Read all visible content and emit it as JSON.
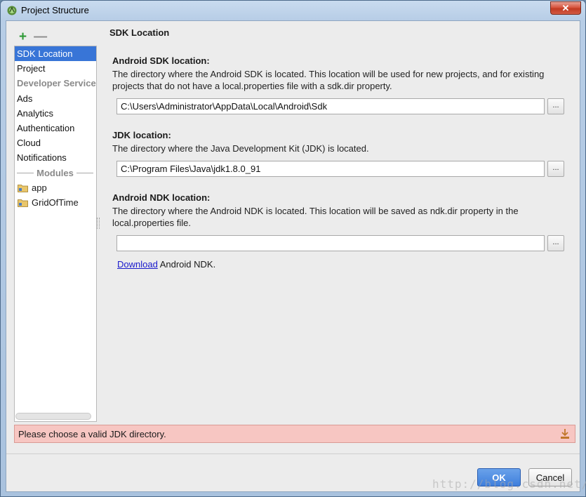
{
  "window": {
    "title": "Project Structure",
    "close_label": "✕"
  },
  "toolbar": {
    "add_label": "+",
    "remove_label": "—"
  },
  "sidebar": {
    "items": [
      {
        "label": "SDK Location",
        "selected": true
      },
      {
        "label": "Project"
      }
    ],
    "dev_services_header": "Developer Services",
    "dev_services": [
      "Ads",
      "Analytics",
      "Authentication",
      "Cloud",
      "Notifications"
    ],
    "modules_header": "Modules",
    "modules": [
      "app",
      "GridOfTime"
    ]
  },
  "main": {
    "section_title": "SDK Location",
    "android_sdk": {
      "title": "Android SDK location:",
      "description": "The directory where the Android SDK is located. This location will be used for new projects, and for existing projects that do not have a local.properties file with a sdk.dir property.",
      "value": "C:\\Users\\Administrator\\AppData\\Local\\Android\\Sdk",
      "browse_label": "..."
    },
    "jdk": {
      "title": "JDK location:",
      "description": "The directory where the Java Development Kit (JDK) is located.",
      "value": "C:\\Program Files\\Java\\jdk1.8.0_91",
      "browse_label": "..."
    },
    "android_ndk": {
      "title": "Android NDK location:",
      "description": "The directory where the Android NDK is located. This location will be saved as ndk.dir property in the local.properties file.",
      "value": "",
      "browse_label": "...",
      "download_link": "Download",
      "download_suffix": " Android NDK."
    }
  },
  "error": {
    "message": "Please choose a valid JDK directory."
  },
  "buttons": {
    "ok": "OK",
    "cancel": "Cancel"
  },
  "watermark": "http://blog.csdn.net/",
  "colors": {
    "selection": "#3875d7",
    "error_bg": "#f7c6c2",
    "ok_button": "#3f7fdc",
    "add_icon": "#2e9a36"
  }
}
